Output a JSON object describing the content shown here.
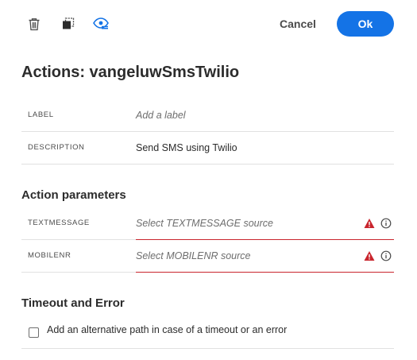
{
  "toolbar": {
    "icons": [
      "trash-icon",
      "duplicate-icon",
      "view-icon"
    ],
    "cancel_label": "Cancel",
    "ok_label": "Ok"
  },
  "page": {
    "title": "Actions: vangeluwSmsTwilio"
  },
  "properties": {
    "label": {
      "name": "LABEL",
      "placeholder": "Add a label"
    },
    "description": {
      "name": "DESCRIPTION",
      "value": "Send SMS using Twilio"
    }
  },
  "action_parameters": {
    "title": "Action parameters",
    "params": [
      {
        "name": "TEXTMESSAGE",
        "placeholder": "Select TEXTMESSAGE source",
        "status": "error"
      },
      {
        "name": "MOBILENR",
        "placeholder": "Select MOBILENR source",
        "status": "error"
      }
    ]
  },
  "timeout": {
    "title": "Timeout and Error",
    "checkbox_label": "Add an alternative path in case of a timeout or an error",
    "checked": false
  },
  "colors": {
    "accent": "#1473e6",
    "error": "#c9252d",
    "view_icon": "#1473e6"
  }
}
